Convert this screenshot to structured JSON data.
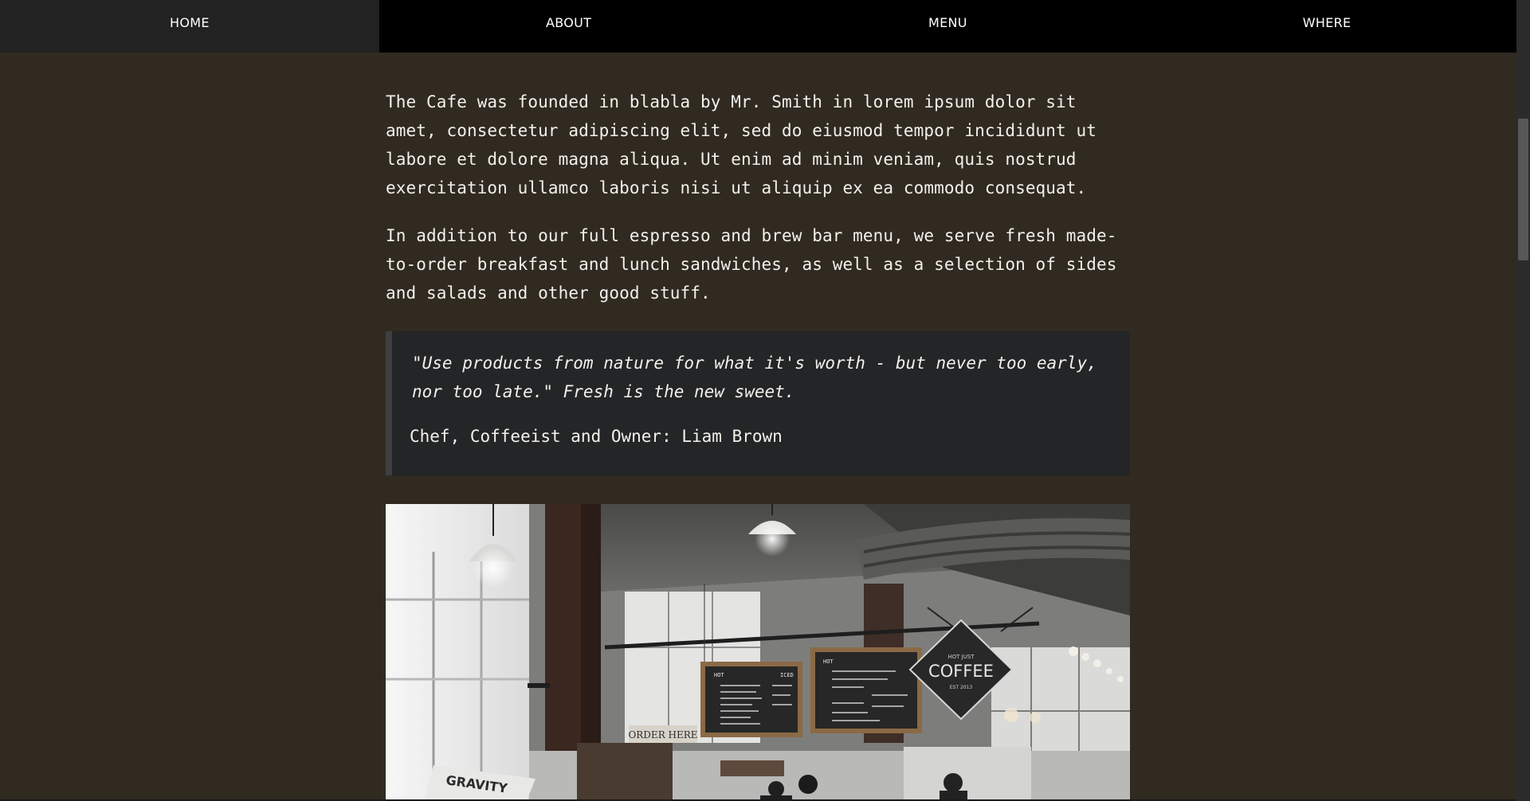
{
  "nav": {
    "items": [
      {
        "label": "HOME"
      },
      {
        "label": "ABOUT"
      },
      {
        "label": "MENU"
      },
      {
        "label": "WHERE"
      }
    ]
  },
  "about": {
    "paragraphs": [
      "The Cafe was founded in blabla by Mr. Smith in lorem ipsum dolor sit amet, consectetur adipiscing elit, sed do eiusmod tempor incididunt ut labore et dolore magna aliqua. Ut enim ad minim veniam, quis nostrud exercitation ullamco laboris nisi ut aliquip ex ea commodo consequat.",
      "In addition to our full espresso and brew bar menu, we serve fresh made-to-order breakfast and lunch sandwiches, as well as a selection of sides and salads and other good stuff."
    ],
    "quote": {
      "text": "\"Use products from nature for what it's worth - but never too early, nor too late.\" Fresh is the new sweet.",
      "author": "Chef, Coffeeist and Owner: Liam Brown"
    },
    "photo": {
      "signs": {
        "hot": "HOT",
        "iced": "ICED",
        "order_here": "ORDER HERE",
        "coffee_sign_top": "HOT JUST",
        "coffee_sign_main": "COFFEE",
        "coffee_sign_bottom": "EST 2013",
        "gravity": "GRAVITY"
      }
    }
  },
  "colors": {
    "page_background": "#302a21",
    "nav_background": "#000000",
    "quote_background": "#232526",
    "quote_border": "#3e3f40",
    "text": "#f3f1ec"
  }
}
